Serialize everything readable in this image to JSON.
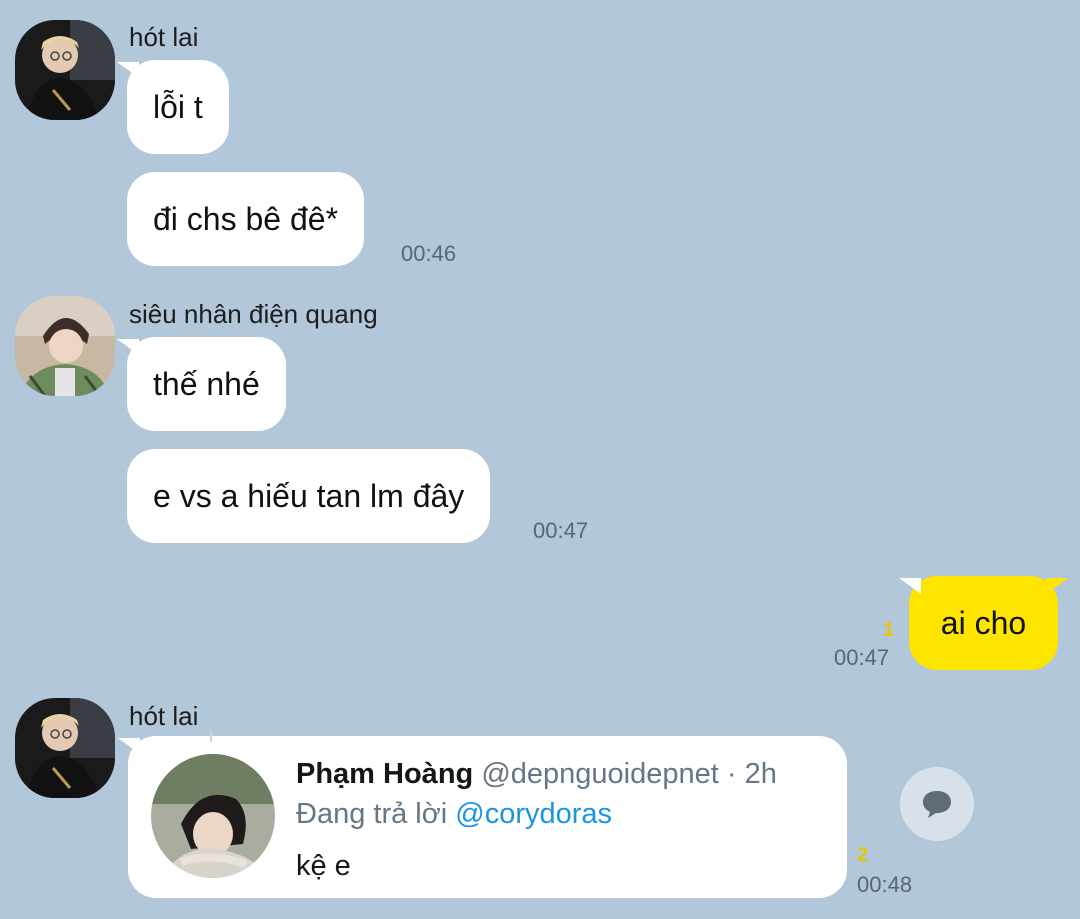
{
  "messages": {
    "group1": {
      "sender": "hót lai",
      "bubbles": [
        "lỗi t",
        "đi chs bê đê*"
      ],
      "time": "00:46"
    },
    "group2": {
      "sender": "siêu nhân điện quang",
      "bubbles": [
        "thế nhé",
        "e vs a hiếu tan lm đây"
      ],
      "time": "00:47"
    },
    "mine": {
      "text": "ai cho",
      "unread": "1",
      "time": "00:47"
    },
    "group3": {
      "sender": "hót lai",
      "card": {
        "name": "Phạm Hoàng",
        "handle": "@depnguoidepnet · 2h",
        "replying_prefix": "Đang trả lời ",
        "replying_to": "@corydoras",
        "text": "kệ e"
      },
      "unread": "2",
      "time": "00:48"
    }
  },
  "icons": {
    "reply": "speech-bubble-icon"
  },
  "colors": {
    "background": "#b2c7da",
    "my_bubble": "#fee500",
    "other_bubble": "#ffffff",
    "unread": "#e6c700",
    "mention": "#1b95e0"
  }
}
